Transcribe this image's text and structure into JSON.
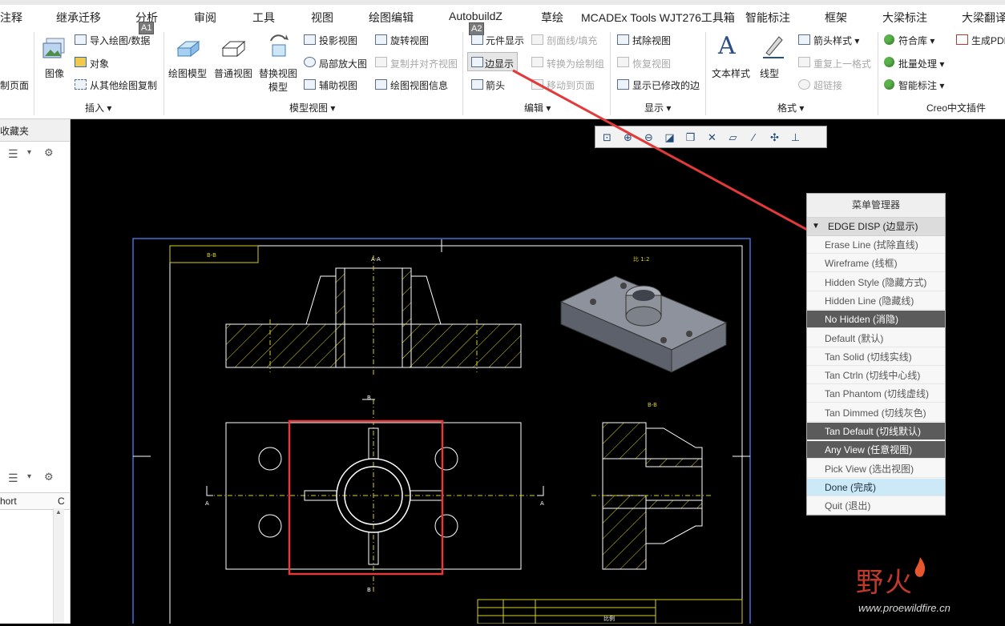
{
  "menubar": {
    "items": [
      "注释",
      "继承迁移",
      "分析",
      "审阅",
      "工具",
      "视图",
      "绘图编辑",
      "AutobuildZ",
      "草绘",
      "MCADEx Tools WJT276工具箱",
      "智能标注",
      "框架",
      "大梁标注",
      "大梁翻译"
    ],
    "badges": [
      "A1",
      "A2"
    ]
  },
  "ribbon": {
    "left_cut": {
      "label": "制页面"
    },
    "insert": {
      "image": "图像",
      "import": "导入绘图/数据",
      "object": "对象",
      "copy_other": "从其他绘图复制",
      "group": "插入"
    },
    "model_views": {
      "drawing_model": "绘图模型",
      "general_view": "普通视图",
      "replace_view": "替换视图",
      "replace_view_2": "模型",
      "projection": "投影视图",
      "detail": "局部放大图",
      "auxiliary": "辅助视图",
      "revolved": "旋转视图",
      "copy_align": "复制并对齐视图",
      "view_info": "绘图视图信息",
      "group": "模型视图"
    },
    "edit": {
      "component_display": "元件显示",
      "xhatch": "剖面线/填充",
      "edge_display": "边显示",
      "convert": "转换为绘制组",
      "arrow": "箭头",
      "move_to_page": "移动到页面",
      "group": "编辑"
    },
    "display": {
      "erase_view": "拭除视图",
      "restore_view": "恢复视图",
      "show_modified": "显示已修改的边",
      "group": "显示"
    },
    "format": {
      "text_style": "文本样式",
      "line_style": "线型",
      "arrow_style": "箭头样式",
      "repeat_format": "重复上一格式",
      "hyperlink": "超链接",
      "group": "格式"
    },
    "plugin": {
      "library": "符合库",
      "batch": "批量处理",
      "smart_dim": "智能标注",
      "pdf": "生成PDF",
      "group": "Creo中文插件"
    }
  },
  "leftpanel": {
    "favorites": "收藏夹",
    "column": "hort",
    "column_b": "C"
  },
  "menu_manager": {
    "title": "菜单管理器",
    "section": "EDGE DISP (边显示)",
    "items": [
      {
        "label": "Erase Line (拭除直线)",
        "state": "normal"
      },
      {
        "label": "Wireframe (线框)",
        "state": "normal"
      },
      {
        "label": "Hidden Style (隐藏方式)",
        "state": "normal"
      },
      {
        "label": "Hidden Line (隐藏线)",
        "state": "normal"
      },
      {
        "label": "No Hidden (消隐)",
        "state": "selected"
      },
      {
        "label": "Default (默认)",
        "state": "normal"
      },
      {
        "label": "Tan Solid (切线实线)",
        "state": "normal"
      },
      {
        "label": "Tan Ctrln (切线中心线)",
        "state": "normal"
      },
      {
        "label": "Tan Phantom (切线虚线)",
        "state": "normal"
      },
      {
        "label": "Tan Dimmed (切线灰色)",
        "state": "normal"
      },
      {
        "label": "Tan Default (切线默认)",
        "state": "selected"
      },
      {
        "label": "Any View (任意视图)",
        "state": "selected"
      },
      {
        "label": "Pick View (选出视图)",
        "state": "normal"
      },
      {
        "label": "Done (完成)",
        "state": "done"
      },
      {
        "label": "Quit (退出)",
        "state": "normal"
      }
    ]
  },
  "drawing": {
    "title_box": "B-B",
    "label_aa": "A-A",
    "label_iso": "比 1:2",
    "label_bb": "B-B",
    "sheet_label": "比例",
    "cut_mark_top": "B",
    "cut_mark_bottom": "B",
    "cut_mark_left": "A",
    "cut_mark_right": "A"
  },
  "watermark": {
    "brand": "野火",
    "url": "www.proewildfire.cn"
  },
  "colors": {
    "accent_red": "#e23a3a",
    "sheet_blue": "#3b73d6",
    "hatch_yellow": "#d8d020",
    "line_white": "#ffffff",
    "selected_gray": "#5b5b5b",
    "done_blue": "#cbe9f6"
  }
}
